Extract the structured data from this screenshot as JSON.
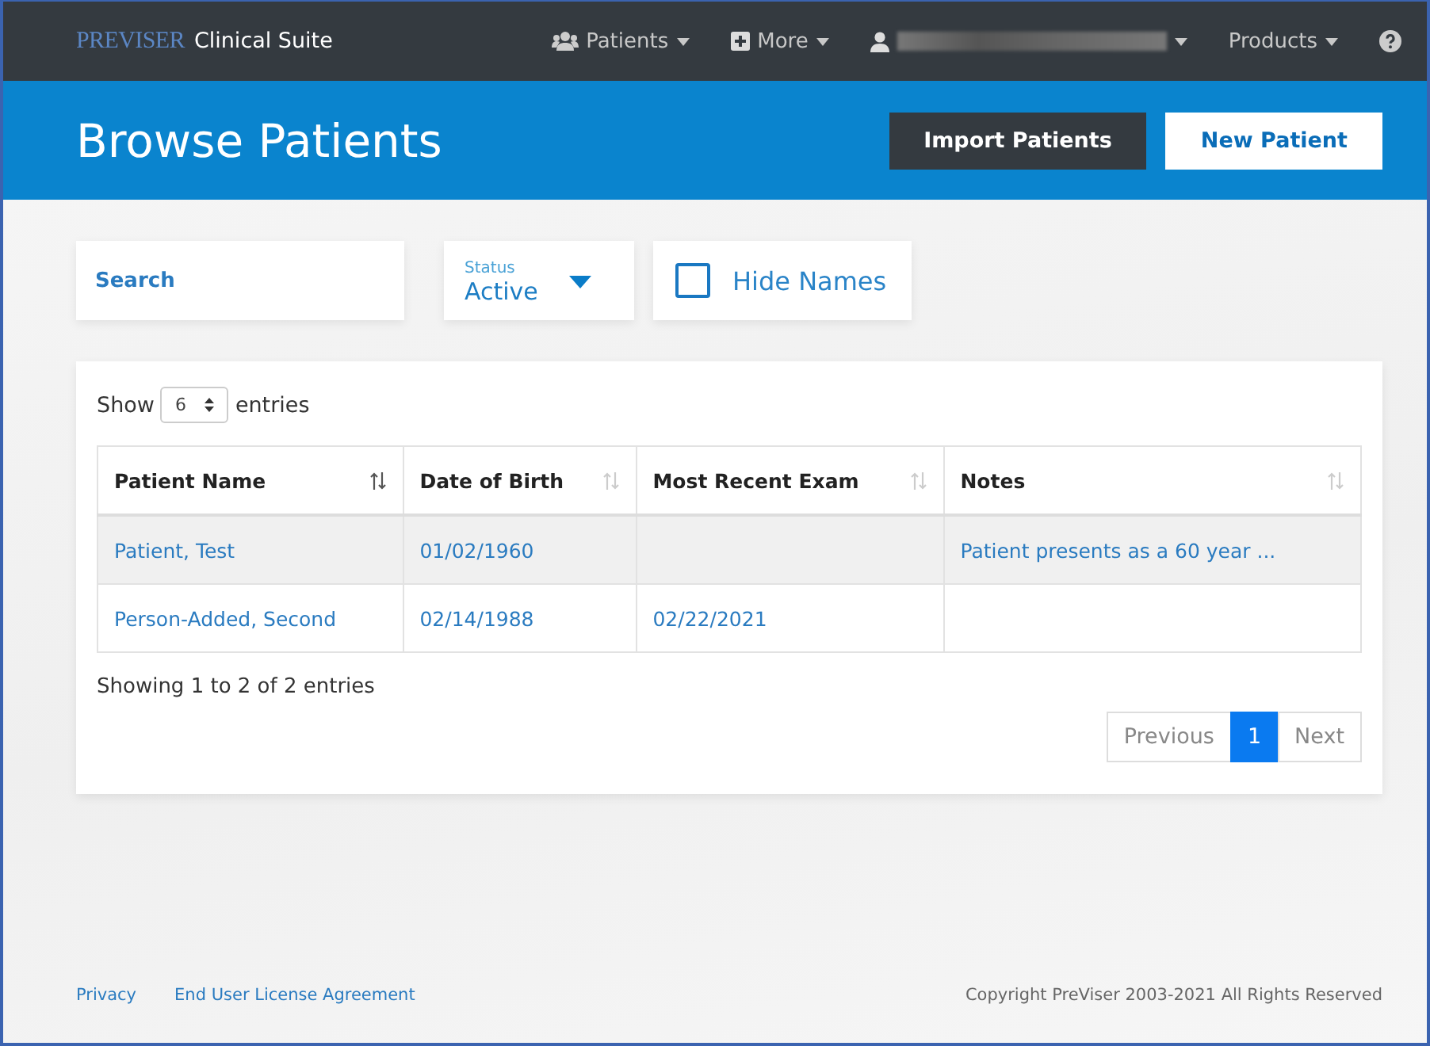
{
  "navbar": {
    "brand": {
      "logo": "PREVISER",
      "name": "Clinical Suite"
    },
    "menus": [
      {
        "kind": "patients",
        "label": "Patients"
      },
      {
        "kind": "more",
        "label": "More"
      },
      {
        "kind": "user"
      },
      {
        "kind": "plain",
        "label": "Products"
      }
    ]
  },
  "header": {
    "title": "Browse Patients",
    "buttons": [
      {
        "kind": "dark",
        "label": "Import Patients"
      },
      {
        "kind": "light",
        "label": "New Patient"
      }
    ]
  },
  "filters": {
    "search": {
      "placeholder": "Search"
    },
    "status": {
      "label": "Status",
      "value": "Active"
    },
    "hide_names": {
      "label": "Hide Names",
      "checked": false
    }
  },
  "table": {
    "show": {
      "before": "Show",
      "value": "6",
      "after": "entries"
    },
    "columns": [
      {
        "label": "Patient Name",
        "sorted": true
      },
      {
        "label": "Date of Birth",
        "sorted": false
      },
      {
        "label": "Most Recent Exam",
        "sorted": false
      },
      {
        "label": "Notes",
        "sorted": false
      }
    ],
    "rows": [
      {
        "selected": true,
        "cells": [
          "Patient, Test",
          "01/02/1960",
          "",
          "Patient presents as a 60 year ..."
        ]
      },
      {
        "selected": false,
        "cells": [
          "Person-Added, Second",
          "02/14/1988",
          "02/22/2021",
          ""
        ]
      }
    ],
    "info": "Showing 1 to 2 of 2 entries",
    "pagination": [
      {
        "label": "Previous",
        "selected": false
      },
      {
        "label": "1",
        "selected": true
      },
      {
        "label": "Next",
        "selected": false
      }
    ]
  },
  "footer": {
    "links": [
      "Privacy",
      "End User License Agreement"
    ],
    "copyright": "Copyright PreViser 2003-2021 All Rights Reserved"
  }
}
